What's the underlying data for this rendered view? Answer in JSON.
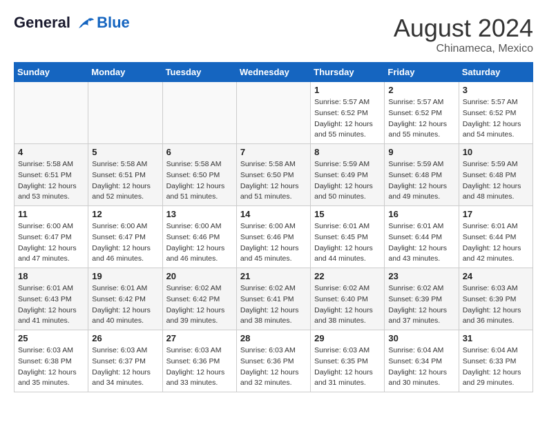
{
  "header": {
    "logo_line1": "General",
    "logo_line2": "Blue",
    "main_title": "August 2024",
    "subtitle": "Chinameca, Mexico"
  },
  "weekdays": [
    "Sunday",
    "Monday",
    "Tuesday",
    "Wednesday",
    "Thursday",
    "Friday",
    "Saturday"
  ],
  "weeks": [
    [
      {
        "day": "",
        "info": ""
      },
      {
        "day": "",
        "info": ""
      },
      {
        "day": "",
        "info": ""
      },
      {
        "day": "",
        "info": ""
      },
      {
        "day": "1",
        "info": "Sunrise: 5:57 AM\nSunset: 6:52 PM\nDaylight: 12 hours\nand 55 minutes."
      },
      {
        "day": "2",
        "info": "Sunrise: 5:57 AM\nSunset: 6:52 PM\nDaylight: 12 hours\nand 55 minutes."
      },
      {
        "day": "3",
        "info": "Sunrise: 5:57 AM\nSunset: 6:52 PM\nDaylight: 12 hours\nand 54 minutes."
      }
    ],
    [
      {
        "day": "4",
        "info": "Sunrise: 5:58 AM\nSunset: 6:51 PM\nDaylight: 12 hours\nand 53 minutes."
      },
      {
        "day": "5",
        "info": "Sunrise: 5:58 AM\nSunset: 6:51 PM\nDaylight: 12 hours\nand 52 minutes."
      },
      {
        "day": "6",
        "info": "Sunrise: 5:58 AM\nSunset: 6:50 PM\nDaylight: 12 hours\nand 51 minutes."
      },
      {
        "day": "7",
        "info": "Sunrise: 5:58 AM\nSunset: 6:50 PM\nDaylight: 12 hours\nand 51 minutes."
      },
      {
        "day": "8",
        "info": "Sunrise: 5:59 AM\nSunset: 6:49 PM\nDaylight: 12 hours\nand 50 minutes."
      },
      {
        "day": "9",
        "info": "Sunrise: 5:59 AM\nSunset: 6:48 PM\nDaylight: 12 hours\nand 49 minutes."
      },
      {
        "day": "10",
        "info": "Sunrise: 5:59 AM\nSunset: 6:48 PM\nDaylight: 12 hours\nand 48 minutes."
      }
    ],
    [
      {
        "day": "11",
        "info": "Sunrise: 6:00 AM\nSunset: 6:47 PM\nDaylight: 12 hours\nand 47 minutes."
      },
      {
        "day": "12",
        "info": "Sunrise: 6:00 AM\nSunset: 6:47 PM\nDaylight: 12 hours\nand 46 minutes."
      },
      {
        "day": "13",
        "info": "Sunrise: 6:00 AM\nSunset: 6:46 PM\nDaylight: 12 hours\nand 46 minutes."
      },
      {
        "day": "14",
        "info": "Sunrise: 6:00 AM\nSunset: 6:46 PM\nDaylight: 12 hours\nand 45 minutes."
      },
      {
        "day": "15",
        "info": "Sunrise: 6:01 AM\nSunset: 6:45 PM\nDaylight: 12 hours\nand 44 minutes."
      },
      {
        "day": "16",
        "info": "Sunrise: 6:01 AM\nSunset: 6:44 PM\nDaylight: 12 hours\nand 43 minutes."
      },
      {
        "day": "17",
        "info": "Sunrise: 6:01 AM\nSunset: 6:44 PM\nDaylight: 12 hours\nand 42 minutes."
      }
    ],
    [
      {
        "day": "18",
        "info": "Sunrise: 6:01 AM\nSunset: 6:43 PM\nDaylight: 12 hours\nand 41 minutes."
      },
      {
        "day": "19",
        "info": "Sunrise: 6:01 AM\nSunset: 6:42 PM\nDaylight: 12 hours\nand 40 minutes."
      },
      {
        "day": "20",
        "info": "Sunrise: 6:02 AM\nSunset: 6:42 PM\nDaylight: 12 hours\nand 39 minutes."
      },
      {
        "day": "21",
        "info": "Sunrise: 6:02 AM\nSunset: 6:41 PM\nDaylight: 12 hours\nand 38 minutes."
      },
      {
        "day": "22",
        "info": "Sunrise: 6:02 AM\nSunset: 6:40 PM\nDaylight: 12 hours\nand 38 minutes."
      },
      {
        "day": "23",
        "info": "Sunrise: 6:02 AM\nSunset: 6:39 PM\nDaylight: 12 hours\nand 37 minutes."
      },
      {
        "day": "24",
        "info": "Sunrise: 6:03 AM\nSunset: 6:39 PM\nDaylight: 12 hours\nand 36 minutes."
      }
    ],
    [
      {
        "day": "25",
        "info": "Sunrise: 6:03 AM\nSunset: 6:38 PM\nDaylight: 12 hours\nand 35 minutes."
      },
      {
        "day": "26",
        "info": "Sunrise: 6:03 AM\nSunset: 6:37 PM\nDaylight: 12 hours\nand 34 minutes."
      },
      {
        "day": "27",
        "info": "Sunrise: 6:03 AM\nSunset: 6:36 PM\nDaylight: 12 hours\nand 33 minutes."
      },
      {
        "day": "28",
        "info": "Sunrise: 6:03 AM\nSunset: 6:36 PM\nDaylight: 12 hours\nand 32 minutes."
      },
      {
        "day": "29",
        "info": "Sunrise: 6:03 AM\nSunset: 6:35 PM\nDaylight: 12 hours\nand 31 minutes."
      },
      {
        "day": "30",
        "info": "Sunrise: 6:04 AM\nSunset: 6:34 PM\nDaylight: 12 hours\nand 30 minutes."
      },
      {
        "day": "31",
        "info": "Sunrise: 6:04 AM\nSunset: 6:33 PM\nDaylight: 12 hours\nand 29 minutes."
      }
    ]
  ]
}
